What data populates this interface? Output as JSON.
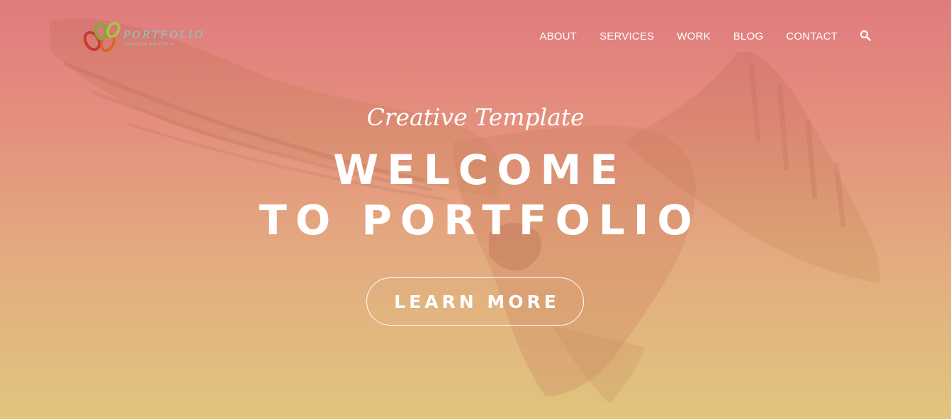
{
  "brand": {
    "name": "PORTFOLIO",
    "tagline_small": "creative portfolio",
    "icon": "flower-logo-icon"
  },
  "nav": {
    "items": [
      {
        "label": "ABOUT"
      },
      {
        "label": "SERVICES"
      },
      {
        "label": "WORK"
      },
      {
        "label": "BLOG"
      },
      {
        "label": "CONTACT"
      }
    ],
    "search_icon": "search-icon"
  },
  "hero": {
    "tagline": "Creative Template",
    "headline_line1": "WELCOME",
    "headline_line2": "TO PORTFOLIO",
    "cta_label": "LEARN MORE",
    "background_image": "eagle-flying"
  },
  "colors": {
    "gradient_top": "#e07b7e",
    "gradient_bottom": "#e0c57d",
    "text": "#ffffff",
    "logo_text": "#7fd1d0"
  }
}
